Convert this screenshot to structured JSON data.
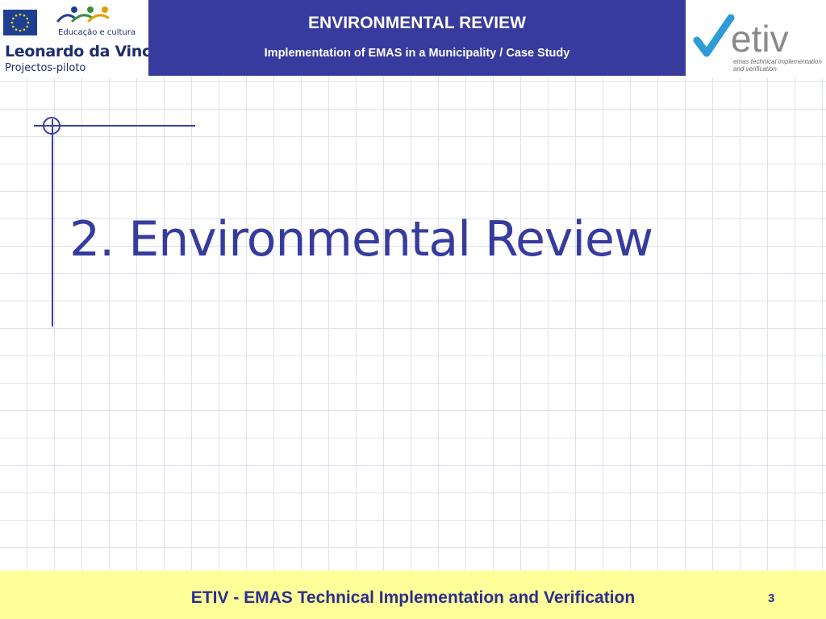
{
  "header": {
    "left_logo": {
      "program_sub": "Educação e cultura",
      "program_name": "Leonardo da Vinci",
      "program_tag": "Projectos-piloto"
    },
    "title": "ENVIRONMENTAL REVIEW",
    "subtitle": "Implementation of EMAS in a Municipality / Case Study",
    "right_logo": {
      "wordmark": "etiv",
      "tagline_line1": "emas technical implementation",
      "tagline_line2": "and verification"
    }
  },
  "slide": {
    "title": "2. Environmental Review"
  },
  "footer": {
    "text": "ETIV - EMAS Technical Implementation and Verification",
    "page_number": "3"
  },
  "colors": {
    "header_band": "#383b9e",
    "title_text": "#383b9e",
    "footer_band": "#ffff99",
    "footer_text": "#2c2f8f",
    "grid_line": "#dde3f0"
  },
  "icons": [
    "eu-flag-icon",
    "people-figures-icon",
    "checkmark-icon"
  ]
}
